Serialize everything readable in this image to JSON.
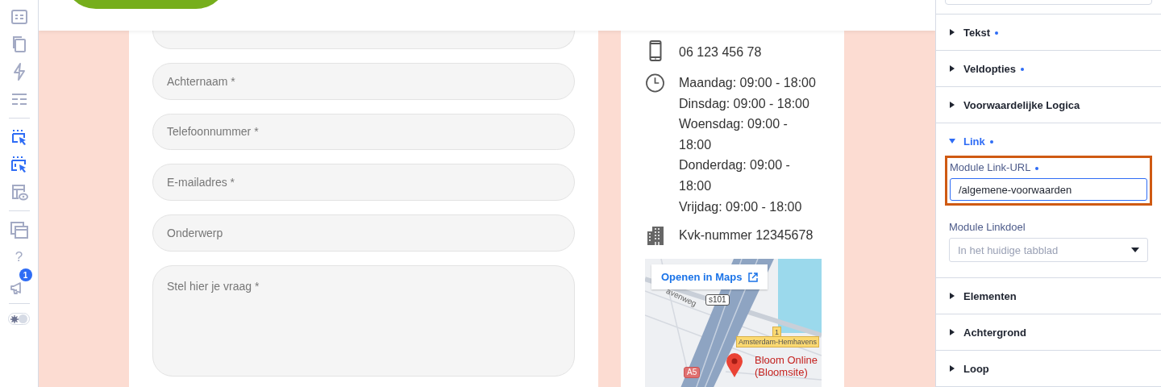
{
  "rail": {
    "groups": [
      [
        {
          "kind": "icon",
          "selected": false
        },
        {
          "kind": "icon",
          "selected": false
        },
        {
          "kind": "icon",
          "selected": false
        },
        {
          "kind": "icon",
          "selected": false
        }
      ],
      [
        {
          "kind": "icon",
          "selected": true
        },
        {
          "kind": "icon",
          "selected": true
        },
        {
          "kind": "icon",
          "selected": false
        }
      ],
      [
        {
          "kind": "icon",
          "selected": false
        },
        {
          "kind": "text",
          "label": "?",
          "selected": false
        },
        {
          "kind": "icon",
          "badge": "1",
          "selected": false
        }
      ],
      [
        {
          "kind": "toggle",
          "on": false
        }
      ]
    ]
  },
  "form": {
    "fields": [
      {
        "kind": "input"
      },
      {
        "kind": "input",
        "placeholder": "Achternaam *"
      },
      {
        "kind": "input",
        "placeholder": "Telefoonnummer *"
      },
      {
        "kind": "input",
        "placeholder": "E-mailadres *"
      },
      {
        "kind": "input",
        "placeholder": "Onderwerp"
      },
      {
        "kind": "textarea",
        "placeholder": "Stel hier je vraag *"
      }
    ]
  },
  "contact": {
    "rows": [
      {
        "lines": [
          "06 123 456 78"
        ]
      },
      {
        "lines": [
          "Maandag: 09:00 - 18:00",
          "Dinsdag: 09:00 - 18:00",
          "Woensdag: 09:00 - 18:00",
          "Donderdag: 09:00 - 18:00",
          "Vrijdag: 09:00 - 18:00"
        ]
      },
      {
        "lines": [
          "Kvk-nummer 12345678"
        ]
      }
    ],
    "map": {
      "open_button": "Openen in Maps",
      "labels": [
        {
          "kind": "street",
          "text": "avenweg"
        },
        {
          "kind": "shield",
          "text": "s101"
        },
        {
          "kind": "station",
          "text": "1"
        },
        {
          "kind": "station",
          "text": "Amsterdam-Hemhavens"
        },
        {
          "kind": "shield",
          "text": "A5"
        },
        {
          "kind": "place",
          "text": "Bloom Online"
        },
        {
          "kind": "place",
          "text": "(Bloomsite)"
        }
      ]
    }
  },
  "settings": {
    "sections": [
      {
        "label": "Tekst",
        "modified": true,
        "expanded": false
      },
      {
        "label": "Veldopties",
        "modified": true,
        "expanded": false
      },
      {
        "label": "Voorwaardelijke Logica",
        "modified": false,
        "expanded": false
      },
      {
        "label": "Link",
        "modified": true,
        "expanded": true,
        "fields": [
          {
            "kind": "text",
            "label": "Module Link-URL",
            "modified": true,
            "highlighted": true,
            "value": "/algemene-voorwaarden"
          },
          {
            "kind": "select",
            "label": "Module Linkdoel",
            "modified": false,
            "highlighted": false,
            "placeholder": "In het huidige tabblad"
          }
        ]
      },
      {
        "label": "Elementen",
        "modified": false,
        "expanded": false
      },
      {
        "label": "Achtergrond",
        "modified": false,
        "expanded": false
      },
      {
        "label": "Loop",
        "modified": false,
        "expanded": false
      }
    ]
  }
}
